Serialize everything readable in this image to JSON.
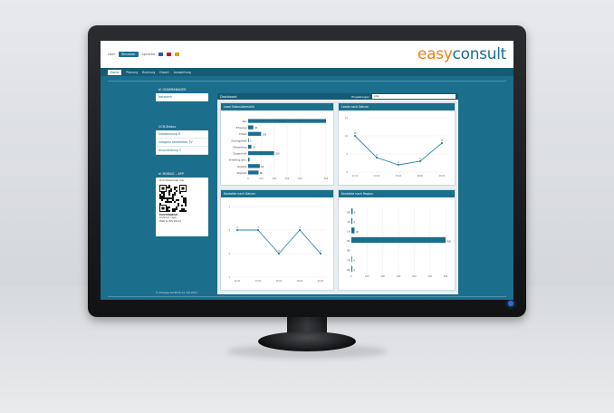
{
  "topbar": {
    "user_label": "User",
    "user_value": "Benutzer",
    "lang_label": "Sprache",
    "flags": [
      "#2a5cb8",
      "#c8102e",
      "#d4a400"
    ],
    "logo_easy": "easy",
    "logo_consult": "consult"
  },
  "nav": {
    "items": [
      "Home",
      "Planung",
      "Buchung",
      "Export",
      "Auswertung"
    ]
  },
  "sidebar": {
    "leadmanager": {
      "title": "e! LEADMANAGER",
      "items": [
        "Netzwerk"
      ]
    },
    "status": {
      "title": "CCR-Status",
      "items": [
        "Infoabholung 8",
        "Infogene bearbeiten TV",
        "Anschreibung 3"
      ]
    },
    "mobile": {
      "title": "e! MOBILE – APP",
      "label": "Zum Download hier",
      "lines": [
        "EASYMOBILE",
        "Android / app",
        "Web & iOS Client"
      ]
    }
  },
  "dashboard": {
    "title": "Dashboard",
    "filter_label": "Eingabungen",
    "filter_value": "Alle"
  },
  "footer": {
    "copyright": "© arbeges GmbH & Co. KG 2017"
  },
  "charts": {
    "lead_status": {
      "title": "Lead Statusübersicht"
    },
    "leads_datum": {
      "title": "Leads nach Datum"
    },
    "kontakte_datum": {
      "title": "Kontakte nach Datum"
    },
    "kontakte_region": {
      "title": "Kontakte nach Region"
    }
  },
  "chart_data": [
    {
      "type": "bar",
      "title": "Lead Statusübersicht",
      "orientation": "horizontal",
      "categories": [
        "Neu",
        "Erfassung",
        "Erfasst",
        "Zurückgestellt",
        "Überprüfung",
        "Eingeschickt",
        "Erstellung sperr.",
        "Verkäufe",
        "Stagniert"
      ],
      "values": [
        600,
        40,
        100,
        5,
        25,
        200,
        10,
        90,
        80
      ],
      "data_labels": [
        "",
        "40",
        "100",
        "5",
        "25",
        "200",
        "",
        "90",
        "80"
      ],
      "xticks": [
        "0",
        "100",
        "200",
        "300",
        "400",
        "600"
      ],
      "xlim": [
        0,
        600
      ]
    },
    {
      "type": "line",
      "title": "Leads nach Datum",
      "x": [
        "11.01",
        "13.01",
        "15.01",
        "18.01",
        "20.01"
      ],
      "values": [
        10,
        4,
        2,
        3,
        8
      ],
      "ylim": [
        0,
        15
      ],
      "yticks": [
        "15",
        "10",
        "5",
        "0"
      ]
    },
    {
      "type": "line",
      "title": "Kontakte nach Datum",
      "x": [
        "11.01",
        "13.01",
        "15.01",
        "18.01",
        "20.01"
      ],
      "values": [
        3,
        3,
        2,
        3,
        2
      ],
      "ylim": [
        1,
        4
      ],
      "yticks": [
        "4",
        "3",
        "2",
        "1"
      ]
    },
    {
      "type": "bar",
      "title": "Kontakte nach Region",
      "orientation": "horizontal",
      "categories": [
        "DE",
        "AT",
        "CH",
        "NL",
        "BE",
        "FR",
        "DK"
      ],
      "values": [
        8,
        6,
        20,
        600,
        0,
        4,
        6
      ],
      "data_labels": [
        "8",
        "6",
        "20",
        "600",
        "",
        "4",
        "6"
      ],
      "xticks": [
        "0",
        "100",
        "200",
        "300",
        "400",
        "500",
        "600"
      ],
      "xlim": [
        0,
        600
      ]
    }
  ]
}
